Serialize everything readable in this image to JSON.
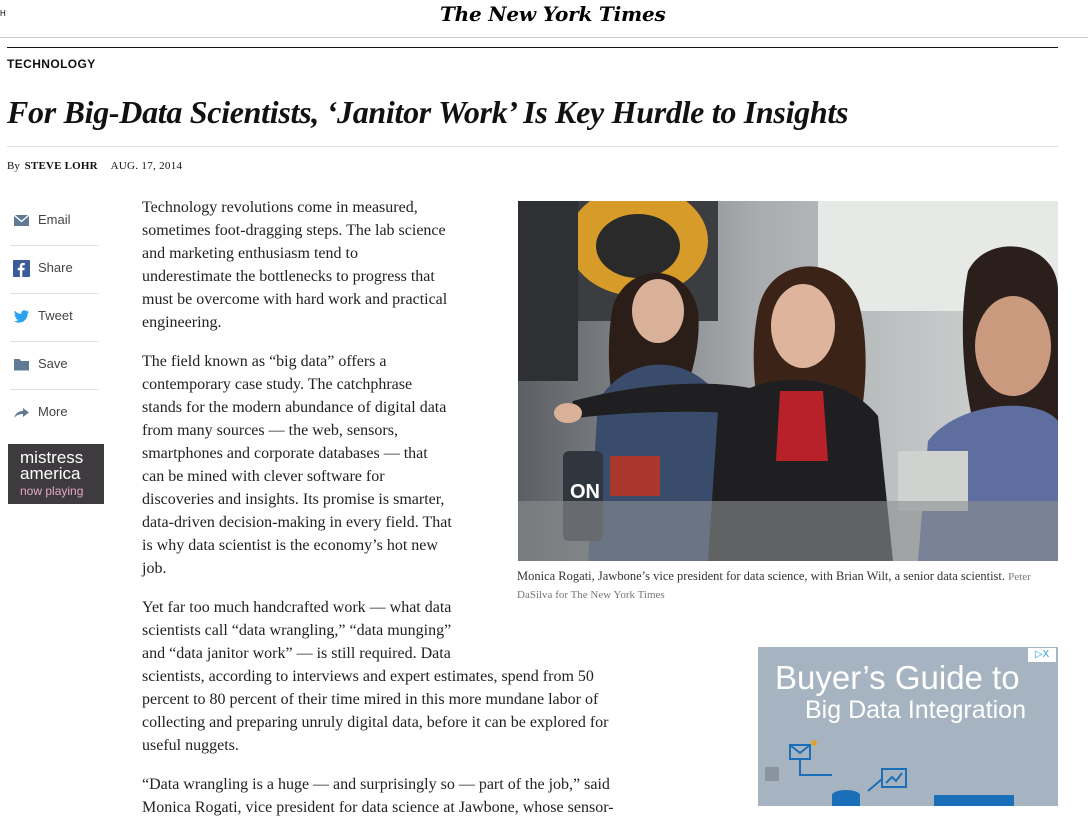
{
  "masthead": {
    "edge_glyph": "H",
    "title": "The New York Times"
  },
  "article": {
    "section": "TECHNOLOGY",
    "headline": "For Big-Data Scientists, ‘Janitor Work’ Is Key Hurdle to Insights",
    "byline_prefix": "By",
    "author": "STEVE LOHR",
    "date": "AUG. 17, 2014"
  },
  "share": {
    "items": [
      {
        "label": "Email",
        "icon": "mail-icon"
      },
      {
        "label": "Share",
        "icon": "facebook-icon"
      },
      {
        "label": "Tweet",
        "icon": "twitter-icon"
      },
      {
        "label": "Save",
        "icon": "folder-icon"
      },
      {
        "label": "More",
        "icon": "share-arrow-icon"
      }
    ]
  },
  "left_ad": {
    "line1": "mistress",
    "line2": "america",
    "line3": "now playing"
  },
  "paragraphs": {
    "p1": [
      "Technology revolutions come in measured,",
      "sometimes foot-dragging steps. The lab science",
      "and marketing enthusiasm tend to",
      "underestimate the bottlenecks to progress that",
      "must be overcome with hard work and practical",
      "engineering."
    ],
    "p2": [
      "The field known as “big data” offers a",
      "contemporary case study. The catchphrase",
      "stands for the modern abundance of digital data",
      "from many sources — the web, sensors,",
      "smartphones and corporate databases — that",
      "can be mined with clever software for",
      "discoveries and insights. Its promise is smarter,",
      "data-driven decision-making in every field. That",
      "is why data scientist is the economy’s hot new",
      "job."
    ],
    "p3": [
      "Yet far too much handcrafted work — what data",
      "scientists call “data wrangling,” “data munging”",
      "and “data janitor work” — is still required. Data",
      "scientists, according to interviews and expert estimates, spend from 50",
      "percent to 80 percent of their time mired in this more mundane labor of",
      "collecting and preparing unruly digital data, before it can be explored for",
      "useful nuggets."
    ],
    "p4": [
      "“Data wrangling is a huge — and surprisingly so — part of the job,” said",
      "Monica Rogati, vice president for data science at Jawbone, whose sensor-"
    ]
  },
  "photo": {
    "caption": "Monica Rogati, Jawbone’s vice president for data science, with Brian Wilt, a senior data scientist.",
    "credit": "Peter DaSilva for The New York Times",
    "overlay_text": "ON"
  },
  "right_ad": {
    "line1": "Buyer’s Guide to",
    "line2": "Big Data Integration",
    "adchoice": "▷X"
  }
}
